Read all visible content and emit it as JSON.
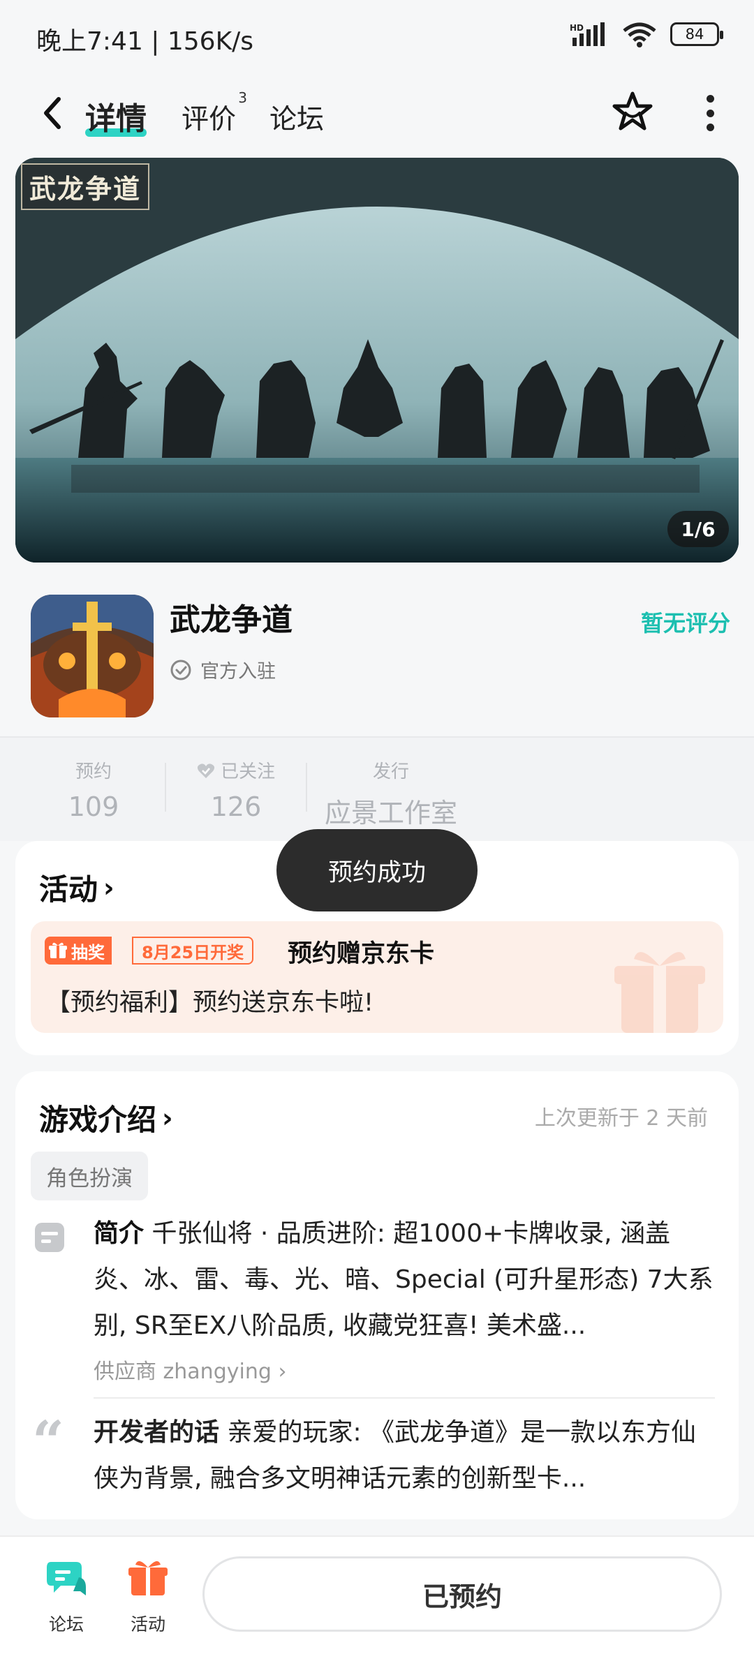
{
  "status_bar": {
    "time": "晚上7:41 | 156K/s",
    "network": "HD",
    "battery": "84"
  },
  "nav": {
    "tabs": [
      {
        "label": "详情",
        "badge": ""
      },
      {
        "label": "评价",
        "badge": "3"
      },
      {
        "label": "论坛",
        "badge": ""
      }
    ]
  },
  "banner": {
    "logo_text": "武龙争道",
    "counter": "1/6"
  },
  "app": {
    "name": "武龙争道",
    "official": "官方入驻",
    "rating": "暂无评分"
  },
  "stats": [
    {
      "label": "预约",
      "value": "109"
    },
    {
      "label": "已关注",
      "value": "126"
    },
    {
      "label": "发行",
      "value": "应景工作室"
    }
  ],
  "toast": "预约成功",
  "activity": {
    "title": "活动",
    "badge": "抽奖",
    "date_badge": "8月25日开奖",
    "item_title": "预约赠京东卡",
    "item_desc": "【预约福利】预约送京东卡啦!"
  },
  "intro": {
    "title": "游戏介绍",
    "updated": "上次更新于 2 天前",
    "tag": "角色扮演",
    "summary_label": "简介",
    "summary": "千张仙将 · 品质进阶: 超1000+卡牌收录, 涵盖炎、冰、雷、毒、光、暗、Special (可升星形态) 7大系别, SR至EX八阶品质, 收藏党狂喜! 美术盛...",
    "supplier": "供应商 zhangying",
    "dev_label": "开发者的话",
    "dev_text": "亲爱的玩家: 《武龙争道》是一款以东方仙侠为背景, 融合多文明神话元素的创新型卡..."
  },
  "bottom_bar": {
    "forum": "论坛",
    "activity": "活动",
    "reserve_button": "已预约"
  },
  "colors": {
    "accent": "#2dd3c4",
    "rating": "#1cbfb0",
    "orange": "#ff6a3a"
  }
}
